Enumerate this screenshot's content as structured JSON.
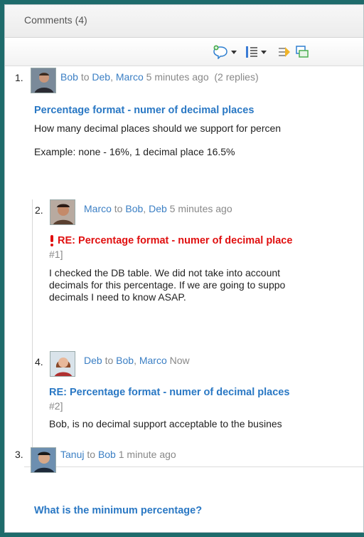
{
  "header": {
    "title": "Comments (4)"
  },
  "toolbar": {
    "icons": [
      "add-comment-icon",
      "sort-list-icon",
      "filter-icon",
      "show-comments-icon"
    ]
  },
  "comments": [
    {
      "number": "1.",
      "author": "Bob",
      "to_word": "to",
      "recipients": [
        "Deb",
        "Marco"
      ],
      "time": "5 minutes ago",
      "replies": "(2 replies)",
      "title": "Percentage format - numer of decimal places",
      "body": [
        "How many decimal places should we support for percen",
        "",
        "Example:  none - 16%,   1 decimal place 16.5%"
      ]
    },
    {
      "number": "2.",
      "author": "Marco",
      "to_word": "to",
      "recipients": [
        "Bob",
        "Deb"
      ],
      "time": "5 minutes ago",
      "title": "RE: Percentage format - numer of decimal place",
      "ref": "#1]",
      "body": [
        "I checked the DB table.  We did not take into account",
        "decimals for this percentage.  If we are going to suppo",
        "decimals I need to know ASAP."
      ]
    },
    {
      "number": "4.",
      "author": "Deb",
      "to_word": "to",
      "recipients": [
        "Bob",
        "Marco"
      ],
      "time": "Now",
      "title": "RE: Percentage format - numer of decimal places",
      "ref": "#2]",
      "body": [
        "Bob, is no decimal support acceptable to the busines"
      ]
    },
    {
      "number": "3.",
      "author": "Tanuj",
      "to_word": "to",
      "recipients": [
        "Bob"
      ],
      "time": "1 minute ago",
      "title": "What is the minimum percentage?"
    }
  ]
}
